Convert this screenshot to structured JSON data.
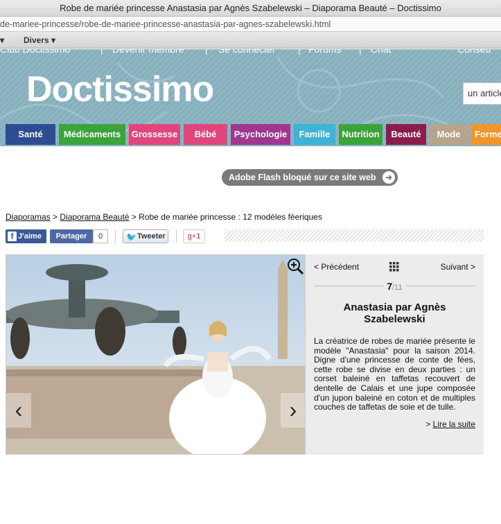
{
  "window": {
    "title": "Robe de mariée princesse Anastasia par Agnès Szabelewski – Diaporama Beauté – Doctissimo",
    "url": "de-mariee-princesse/robe-de-mariee-princesse-anastasia-par-agnes-szabelewski.html"
  },
  "bookmarks": {
    "item1": "▾",
    "item2": "Divers ▾"
  },
  "header": {
    "topnav": [
      "Club Doctissimo",
      "|",
      "Devenir membre",
      "|",
      "Se connecter",
      "|",
      "Forums",
      "|",
      "Chat",
      "Conseu"
    ],
    "logo": "Doctissimo",
    "search_placeholder": "un article"
  },
  "nav": {
    "tabs": [
      {
        "label": "Santé",
        "color": "#2c4d8f"
      },
      {
        "label": "Médicaments",
        "color": "#3aa43a"
      },
      {
        "label": "Grossesse",
        "color": "#e2447c"
      },
      {
        "label": "Bébé",
        "color": "#e2447c"
      },
      {
        "label": "Psychologie",
        "color": "#a0368f"
      },
      {
        "label": "Famille",
        "color": "#3fb3d6"
      },
      {
        "label": "Nutrition",
        "color": "#3aa43a"
      },
      {
        "label": "Beauté",
        "color": "#8b1c4c"
      },
      {
        "label": "Mode",
        "color": "#b8a48c"
      },
      {
        "label": "Forme",
        "color": "#f2962b"
      }
    ]
  },
  "flash": {
    "label": "Adobe Flash bloqué sur ce site web",
    "arrow": "➔"
  },
  "breadcrumb": {
    "item1": "Diaporamas",
    "sep1": " > ",
    "item2": "Diaporama Beauté",
    "sep2": " > ",
    "item3": "Robe de mariée princesse : 12 modèles féeriques"
  },
  "social": {
    "like_icon": "f",
    "like_label": "J'aime",
    "share_label": "Partager",
    "share_count": "0",
    "tweet_label": "Tweeter",
    "gplus_label": "g+1"
  },
  "slide": {
    "prev_arrow": "‹",
    "next_arrow": "›",
    "zoom_icon": "zoom-in-icon"
  },
  "side": {
    "prev": "< Précédent",
    "next": "Suivant >",
    "current": "7",
    "total": "/11",
    "title": "Anastasia par Agnès Szabelewski",
    "description": "La créatrice de robes de mariée présente le modèle \"Anastasia\" pour la saison 2014. Digne d'une princesse de conte de fées, cette robe se divise en deux parties : un corset baleiné en taffetas recouvert de dentelle de Calais et une jupe composée d'un jupon baleiné en coton et de multiples couches de taffetas de soie et de tulle.",
    "more_prefix": "> ",
    "more_label": "Lire la suite"
  }
}
